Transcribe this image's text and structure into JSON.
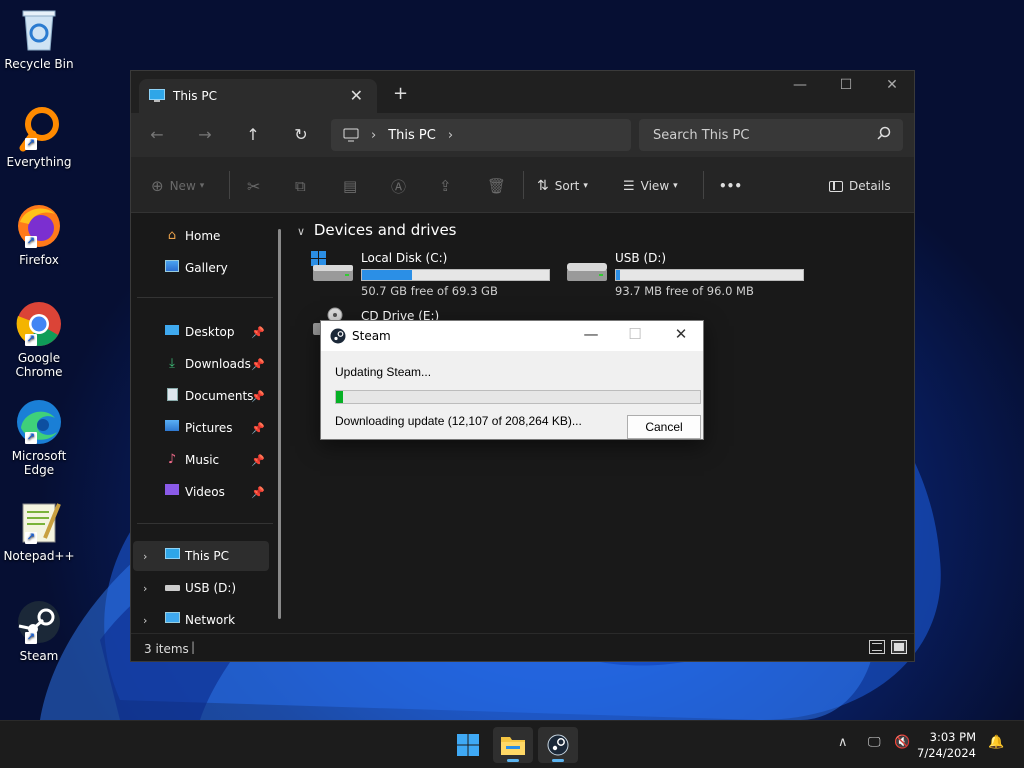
{
  "desktop": {
    "icons": [
      {
        "label": "Recycle Bin"
      },
      {
        "label": "Everything"
      },
      {
        "label": "Firefox"
      },
      {
        "label": "Google Chrome"
      },
      {
        "label": "Microsoft Edge"
      },
      {
        "label": "Notepad++"
      },
      {
        "label": "Steam"
      }
    ]
  },
  "explorer": {
    "tab_title": "This PC",
    "tab_close": "✕",
    "new_tab": "+",
    "controls": {
      "minimize": "—",
      "maximize": "☐",
      "close": "✕"
    },
    "nav": {
      "back": "←",
      "forward": "→",
      "up": "↑",
      "refresh": "↻"
    },
    "address": {
      "crumb": "This PC",
      "sep": "›"
    },
    "search": {
      "placeholder": "Search This PC"
    },
    "commands": {
      "new": "New",
      "sort": "Sort",
      "view": "View",
      "more": "•••",
      "details": "Details"
    },
    "sidebar": {
      "items": [
        {
          "label": "Home"
        },
        {
          "label": "Gallery"
        },
        {
          "label": "Desktop"
        },
        {
          "label": "Downloads"
        },
        {
          "label": "Documents"
        },
        {
          "label": "Pictures"
        },
        {
          "label": "Music"
        },
        {
          "label": "Videos"
        },
        {
          "label": "This PC"
        },
        {
          "label": "USB (D:)"
        },
        {
          "label": "Network"
        }
      ]
    },
    "content": {
      "section": "Devices and drives",
      "drives": [
        {
          "name": "Local Disk (C:)",
          "free": "50.7 GB free of 69.3 GB",
          "used_fraction": 0.27
        },
        {
          "name": "USB (D:)",
          "free": "93.7 MB free of 96.0 MB",
          "used_fraction": 0.02
        },
        {
          "name": "CD Drive (E:)"
        }
      ]
    },
    "status": {
      "items": "3 items"
    }
  },
  "steam_dialog": {
    "title": "Steam",
    "heading": "Updating Steam...",
    "progress_fraction": 0.02,
    "detail": "Downloading update (12,107 of 208,264 KB)...",
    "cancel": "Cancel"
  },
  "taskbar": {
    "time": "3:03 PM",
    "date": "7/24/2024"
  },
  "colors": {
    "accent": "#2b8fe6",
    "progress_green": "#06b025",
    "explorer_bg": "#191919"
  }
}
